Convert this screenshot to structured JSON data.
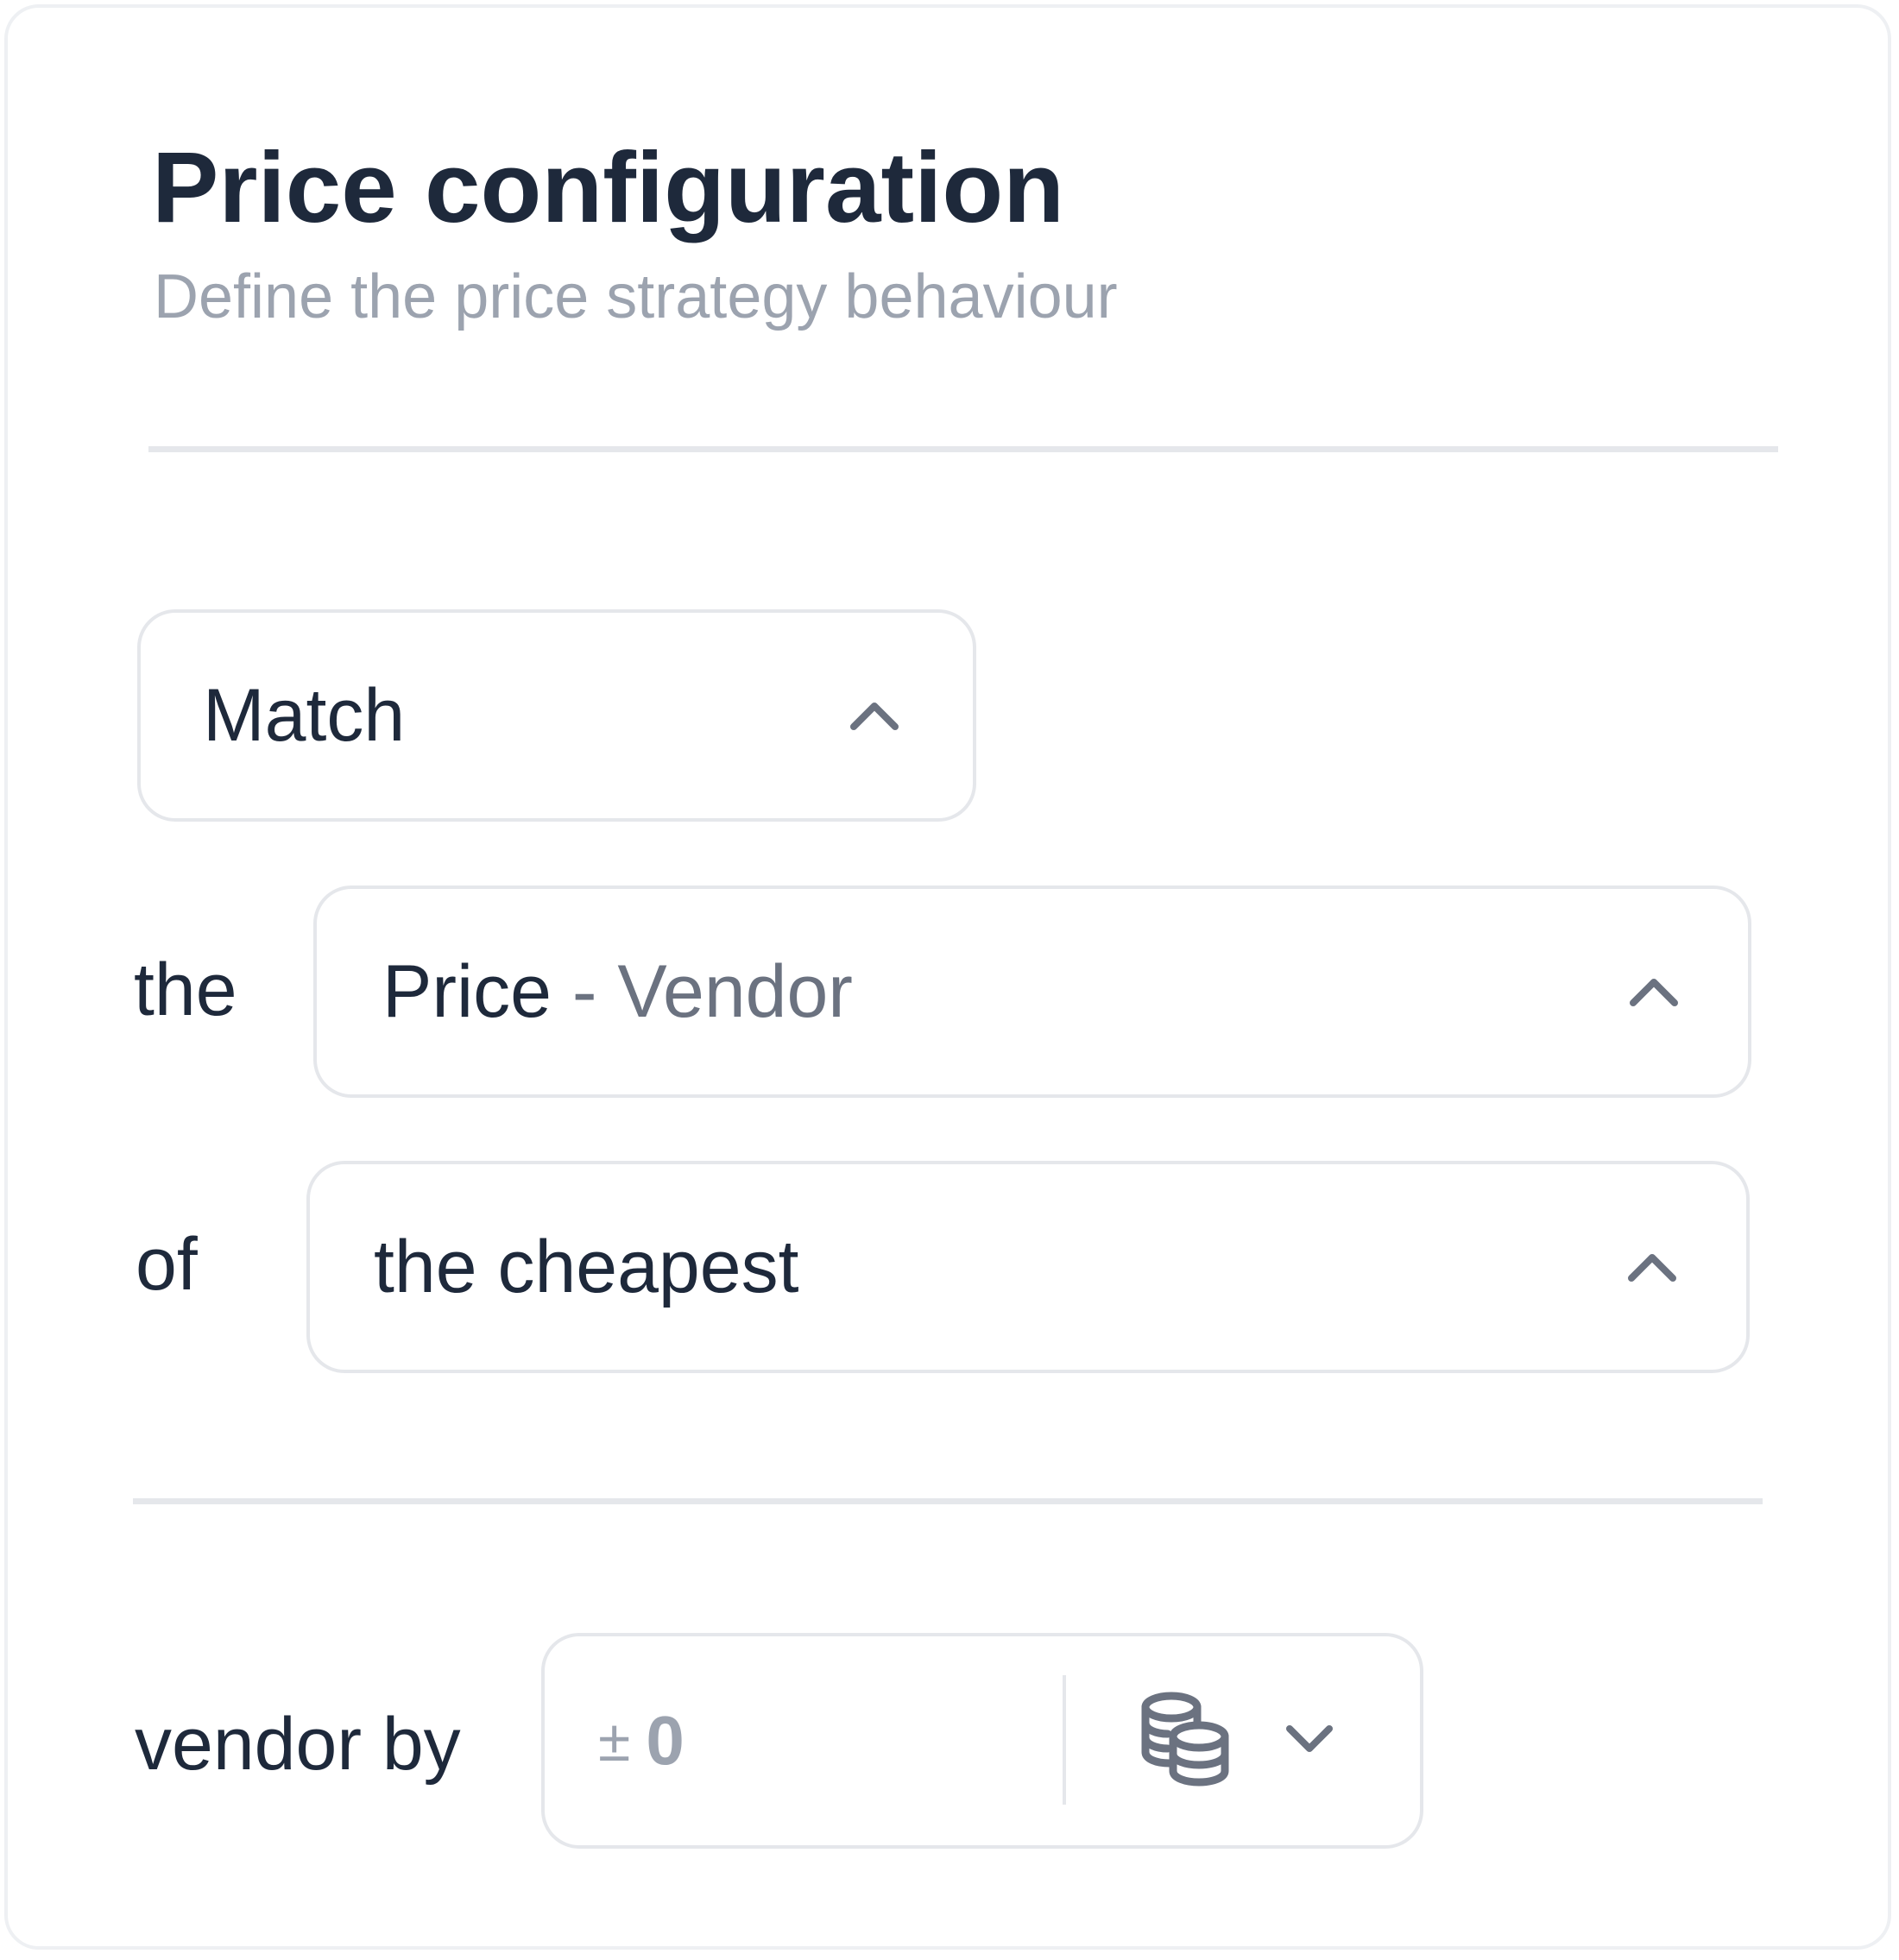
{
  "header": {
    "title": "Price configuration",
    "subtitle": "Define the price strategy behaviour"
  },
  "strategy": {
    "action_select": {
      "value": "Match",
      "icon": "chevron-up-icon"
    },
    "attribute_row": {
      "prefix": "the",
      "select": {
        "value_main": "Price",
        "value_secondary": "- Vendor",
        "icon": "chevron-up-icon"
      }
    },
    "target_row": {
      "prefix": "of",
      "select": {
        "value": "the cheapest",
        "icon": "chevron-up-icon"
      }
    }
  },
  "adjustment": {
    "label": "vendor by",
    "amount_sign": "±",
    "amount_value": "0",
    "unit_icon": "coins-icon",
    "unit_dropdown_icon": "chevron-down-icon"
  },
  "colors": {
    "text_primary": "#1e293b",
    "text_muted": "#9ca3af",
    "icon": "#6b7280",
    "border": "#e5e7eb"
  }
}
